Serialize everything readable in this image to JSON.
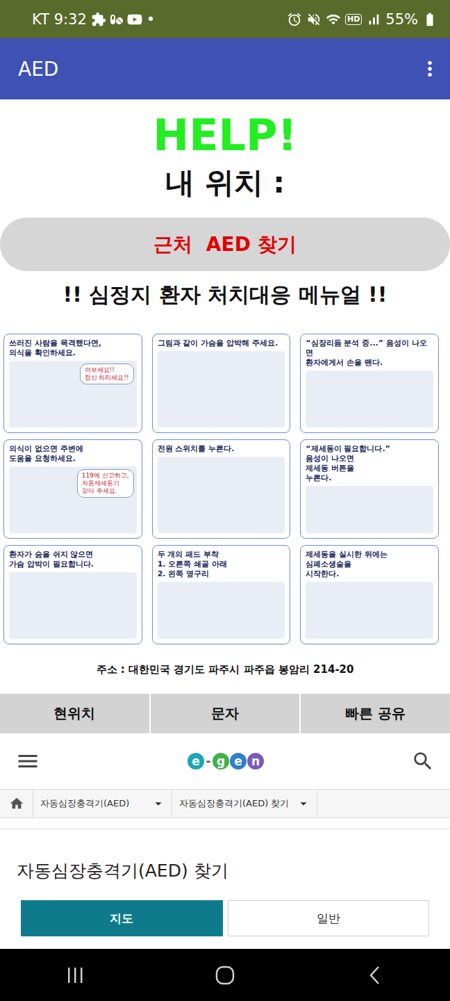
{
  "status_bar": {
    "carrier_time": "KT 9:32",
    "dot": "•",
    "hd": "HD",
    "battery": "55%"
  },
  "app_bar": {
    "title": "AED"
  },
  "help": "HELP!",
  "location_label": "내 위치 :",
  "find_button": "근처  AED 찾기",
  "manual_title": "!! 심정지 환자 처치대응 메뉴얼 !!",
  "steps": [
    {
      "caption": "쓰러진 사람을 목격했다면,\n의식을 확인하세요.",
      "bubble": "여보세요!!\n정신 차리세요!!"
    },
    {
      "caption": "그림과 같이 가슴을 압박해 주세요."
    },
    {
      "caption": "“심장리듬 분석 중...” 음성이 나오면\n환자에게서 손을 뗀다."
    },
    {
      "caption": "의식이 없으면 주변에\n도움을 요청하세요.",
      "bubble": "119에 신고하고,\n자동제세동기\n갖다 주세요."
    },
    {
      "caption": "전원 스위치를 누른다."
    },
    {
      "caption": "“제세동이 필요합니다.”\n음성이 나오면\n제세동 버튼을\n누른다."
    },
    {
      "caption": "환자가 숨을 쉬지 않으면\n가슴 압박이 필요합니다."
    },
    {
      "caption": "두 개의 패드 부착\n1. 오른쪽 쇄골 아래\n2. 왼쪽 옆구리"
    },
    {
      "caption": "제세동을 실시한 뒤에는\n심폐소생술을\n시작한다."
    }
  ],
  "address": "주소 : 대한민국 경기도 파주시 파주읍 봉암리 214-20",
  "actions": [
    "현위치",
    "문자",
    "빠른 공유"
  ],
  "web": {
    "logo": "e-gen",
    "breadcrumb": [
      "자동심장충격기(AED)",
      "자동심장충격기(AED) 찾기"
    ],
    "heading": "자동심장충격기(AED) 찾기",
    "tabs": [
      {
        "label": "지도",
        "selected": true
      },
      {
        "label": "일반",
        "selected": false
      }
    ]
  }
}
